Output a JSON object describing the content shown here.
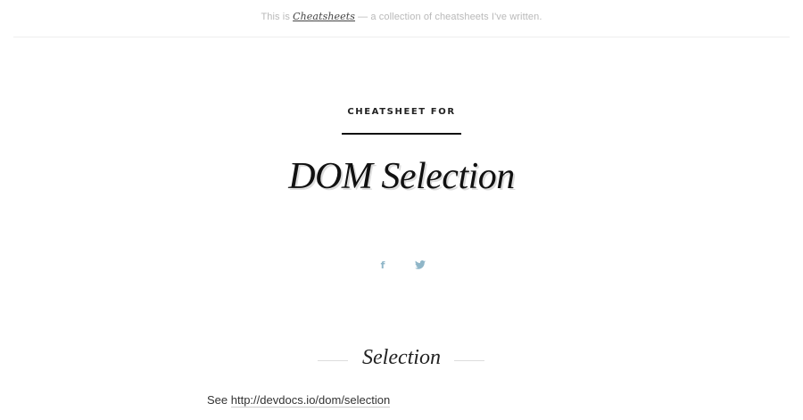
{
  "topbar": {
    "prefix": "This is ",
    "link_text": "Cheatsheets",
    "suffix": " — a collection of cheatsheets I've written."
  },
  "header": {
    "pre_title": "CHEATSHEET FOR",
    "title": "DOM Selection"
  },
  "social": {
    "facebook_glyph": "f",
    "icons": [
      "facebook-icon",
      "twitter-icon"
    ],
    "color": "#8fb6c8"
  },
  "section": {
    "title": "Selection",
    "see_text": "See ",
    "link_text": "http://devdocs.io/dom/selection"
  }
}
